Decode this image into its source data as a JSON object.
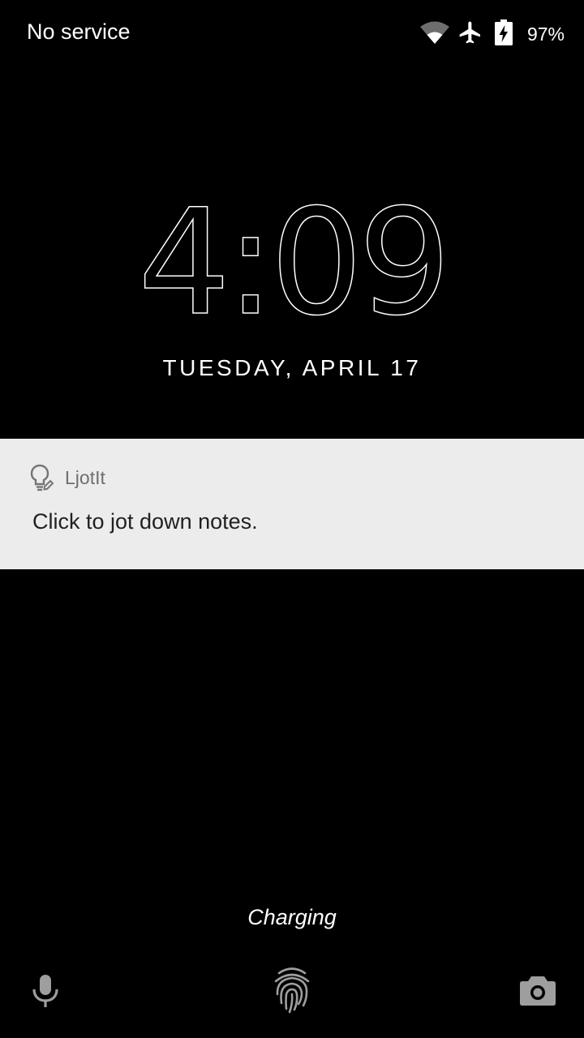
{
  "status_bar": {
    "carrier": "No service",
    "battery_percent": "97%",
    "icons": [
      "wifi-icon",
      "airplane-mode-icon",
      "battery-charging-icon"
    ]
  },
  "lock_screen": {
    "time": "4:09",
    "date": "TUESDAY, APRIL 17"
  },
  "notification": {
    "app_name": "LjotIt",
    "icon": "lightbulb-note-icon",
    "text": "Click to jot down notes."
  },
  "indication": "Charging",
  "bottom_actions": {
    "left": "microphone-icon",
    "center": "fingerprint-icon",
    "right": "camera-icon"
  },
  "colors": {
    "background": "#000000",
    "notification_bg": "#ececec",
    "notification_app_text": "#6f6f6f",
    "notification_text": "#212121",
    "icon_gray": "#9e9e9e"
  }
}
